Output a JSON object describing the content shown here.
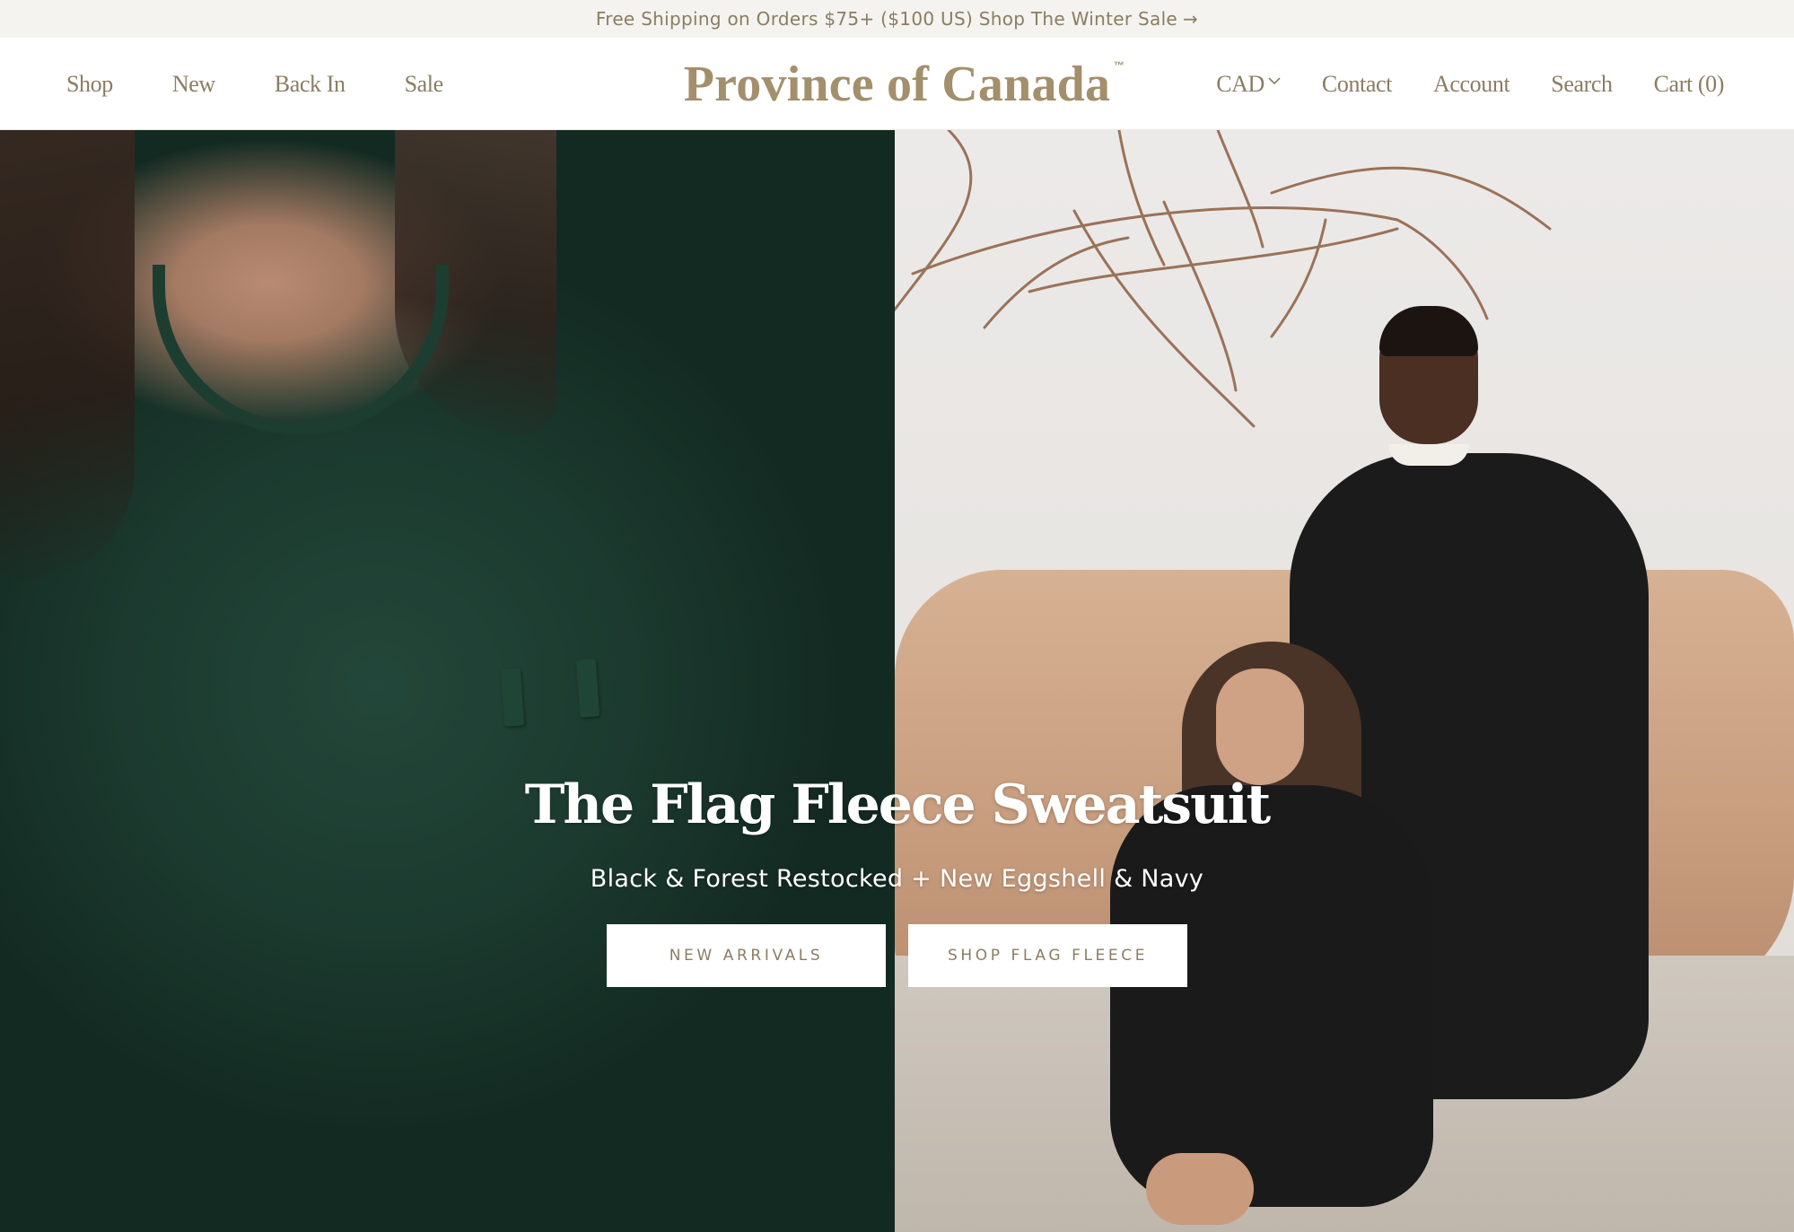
{
  "announcement": {
    "text": "Free Shipping on Orders $75+ ($100 US) Shop The Winter Sale",
    "arrow": "→"
  },
  "header": {
    "nav_left": [
      "Shop",
      "New",
      "Back In",
      "Sale"
    ],
    "logo": "Province of Canada",
    "logo_tm": "™",
    "currency": "CAD",
    "nav_right": [
      "Contact",
      "Account",
      "Search",
      "Cart (0)"
    ]
  },
  "hero": {
    "title": "The Flag Fleece Sweatsuit",
    "subtitle": "Black & Forest Restocked + New Eggshell & Navy",
    "buttons": [
      "NEW ARRIVALS",
      "SHOP FLAG FLEECE"
    ]
  },
  "colors": {
    "accent": "#8b7d62",
    "logo": "#a38f6b",
    "announcement_bg": "#f4f3ef",
    "forest": "#1c3a2f"
  },
  "icons": {
    "currency_dropdown": "chevron-down-icon",
    "announcement_arrow": "arrow-right-icon"
  }
}
